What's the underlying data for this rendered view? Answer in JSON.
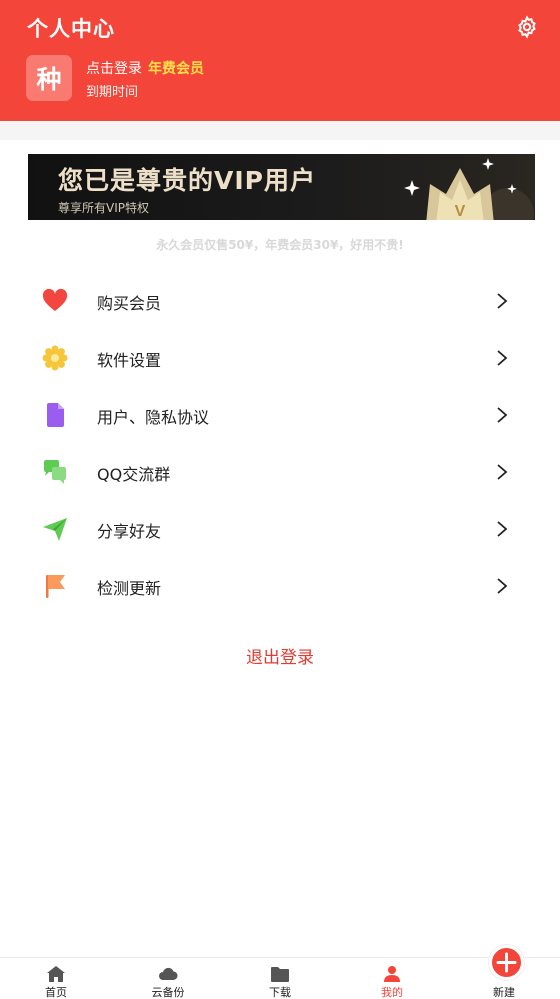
{
  "header": {
    "title": "个人中心",
    "logo_char": "种",
    "login_text": "点击登录",
    "vip_tag": "年费会员",
    "expire_text": "到期时间",
    "settings_icon": "gear-icon"
  },
  "banner": {
    "title": "您已是尊贵的VIP用户",
    "subtitle": "尊享所有VIP特权"
  },
  "promo_text": "永久会员仅售50¥，年费会员30¥，好用不贵!",
  "menu": {
    "items": [
      {
        "label": "购买会员",
        "icon": "heart-icon",
        "color": "#f2463f"
      },
      {
        "label": "软件设置",
        "icon": "gear-flower-icon",
        "color": "#f6c63a"
      },
      {
        "label": "用户、隐私协议",
        "icon": "document-icon",
        "color": "#9b5cf0"
      },
      {
        "label": "QQ交流群",
        "icon": "chat-bubbles-icon",
        "color": "#5fcb55"
      },
      {
        "label": "分享好友",
        "icon": "paper-plane-icon",
        "color": "#5fcb55"
      },
      {
        "label": "检测更新",
        "icon": "flag-icon",
        "color": "#fa9a5d"
      }
    ]
  },
  "logout_label": "退出登录",
  "tabbar": {
    "tabs": [
      {
        "label": "首页",
        "icon": "home-icon"
      },
      {
        "label": "云备份",
        "icon": "cloud-icon"
      },
      {
        "label": "下载",
        "icon": "folder-icon"
      },
      {
        "label": "我的",
        "icon": "person-icon",
        "active": true
      },
      {
        "label": "新建",
        "icon": "plus-icon"
      }
    ]
  },
  "colors": {
    "accent": "#f4453a",
    "vip_gold": "#ffe24a"
  }
}
